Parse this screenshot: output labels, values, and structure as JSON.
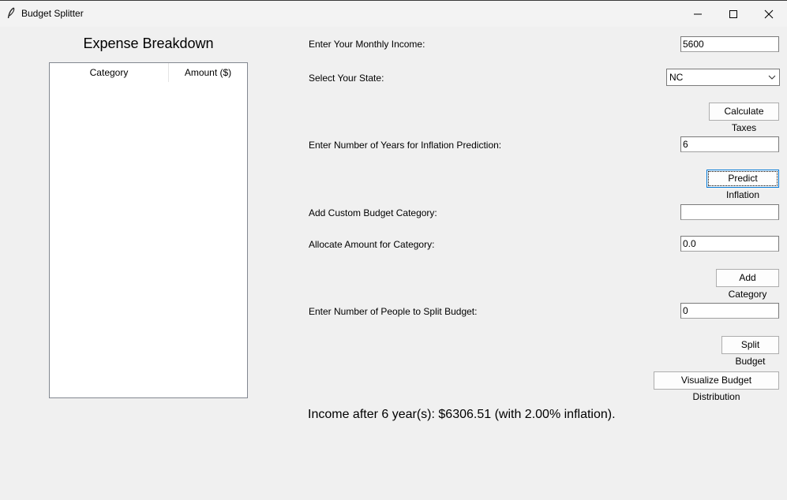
{
  "window": {
    "title": "Budget Splitter",
    "app_icon": "feather-icon"
  },
  "expense_panel": {
    "title": "Expense Breakdown",
    "columns": [
      "Category",
      "Amount ($)"
    ],
    "rows": []
  },
  "form": {
    "income_label": "Enter Your Monthly Income:",
    "income_value": "5600",
    "state_label": "Select Your State:",
    "state_value": "NC",
    "calculate_taxes_label": "Calculate Taxes",
    "years_label": "Enter Number of Years for Inflation Prediction:",
    "years_value": "6",
    "predict_inflation_label": "Predict Inflation",
    "custom_category_label": "Add Custom Budget Category:",
    "custom_category_value": "",
    "allocate_label": "Allocate Amount for Category:",
    "allocate_value": "0.0",
    "add_category_label": "Add Category",
    "people_label": "Enter Number of People to Split Budget:",
    "people_value": "0",
    "split_budget_label": "Split Budget",
    "visualize_label": "Visualize Budget Distribution"
  },
  "result_text": "Income after 6 year(s): $6306.51 (with 2.00% inflation)."
}
